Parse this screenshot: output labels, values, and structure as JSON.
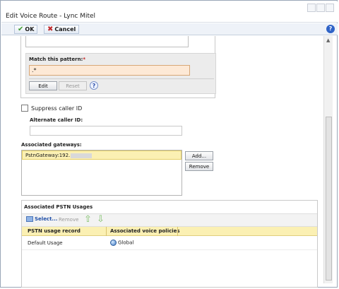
{
  "window": {
    "title": "Edit Voice Route - Lync Mitel"
  },
  "toolbar": {
    "ok_label": "OK",
    "cancel_label": "Cancel",
    "help_label": "?"
  },
  "pattern": {
    "label": "Match this pattern:",
    "required_mark": "*",
    "value": ".*",
    "edit_label": "Edit",
    "reset_label": "Reset",
    "help_label": "?"
  },
  "suppress": {
    "label": "Suppress caller ID",
    "checked": false
  },
  "alternate": {
    "label": "Alternate caller ID:",
    "value": ""
  },
  "gateways": {
    "label": "Associated gateways:",
    "items": [
      "PstnGateway:192."
    ],
    "add_label": "Add...",
    "remove_label": "Remove"
  },
  "pstn": {
    "title": "Associated PSTN Usages",
    "select_label": "Select...",
    "remove_label": "Remove",
    "columns": [
      "PSTN usage record",
      "Associated voice policies"
    ],
    "rows": [
      {
        "record": "Default Usage",
        "policy": "Global"
      }
    ]
  },
  "icons": {
    "ok": "checkmark-icon",
    "cancel": "x-icon",
    "help": "help-icon",
    "up": "up-arrow-icon",
    "down": "down-arrow-icon",
    "globe": "globe-icon",
    "select": "select-icon"
  },
  "colors": {
    "highlight": "#fbf0b3",
    "required_input": "#fde9d6",
    "help_blue": "#2f63c7"
  }
}
